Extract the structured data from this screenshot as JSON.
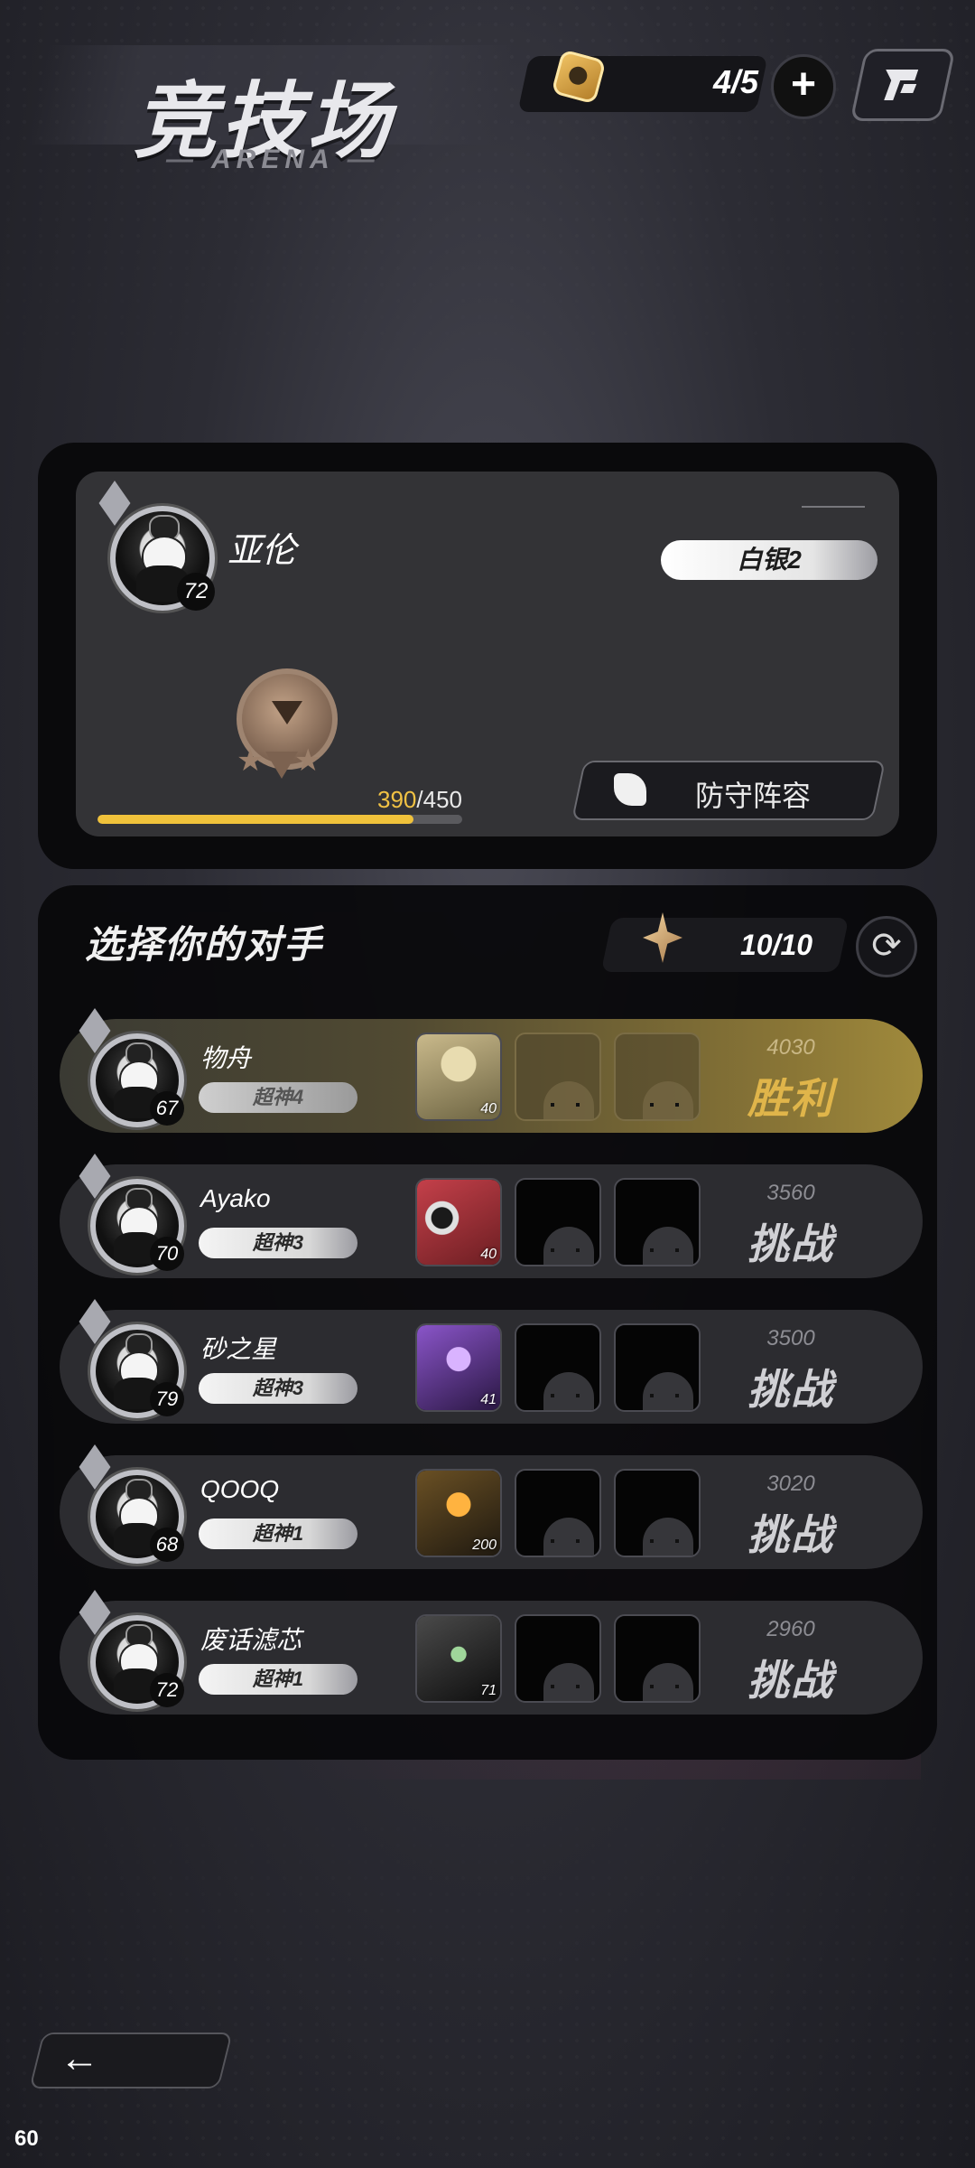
{
  "header": {
    "title": "竞技场",
    "subtitle": "ARENA",
    "tickets": "4/5",
    "plus_label": "+"
  },
  "player": {
    "name": "亚伦",
    "level": "72",
    "rank": "白银2",
    "points_current": "390",
    "points_total": "/450",
    "progress": 0.867,
    "defense_label": "防守阵容"
  },
  "opponents_panel": {
    "title": "选择你的对手",
    "challenges": "10/10"
  },
  "opponents": [
    {
      "name": "物舟",
      "level": "67",
      "rank": "超神4",
      "hero_level": "40",
      "power": "4030",
      "action": "胜利",
      "won": true
    },
    {
      "name": "Ayako",
      "level": "70",
      "rank": "超神3",
      "hero_level": "40",
      "power": "3560",
      "action": "挑战",
      "won": false
    },
    {
      "name": "砂之星",
      "level": "79",
      "rank": "超神3",
      "hero_level": "41",
      "power": "3500",
      "action": "挑战",
      "won": false
    },
    {
      "name": "QOOQ",
      "level": "68",
      "rank": "超神1",
      "hero_level": "200",
      "power": "3020",
      "action": "挑战",
      "won": false
    },
    {
      "name": "废话滤芯",
      "level": "72",
      "rank": "超神1",
      "hero_level": "71",
      "power": "2960",
      "action": "挑战",
      "won": false
    }
  ],
  "footer": {
    "back_icon": "←",
    "fps": "60"
  },
  "colors": {
    "accent_gold": "#f0c23b",
    "win_gold": "#e0b54a"
  }
}
